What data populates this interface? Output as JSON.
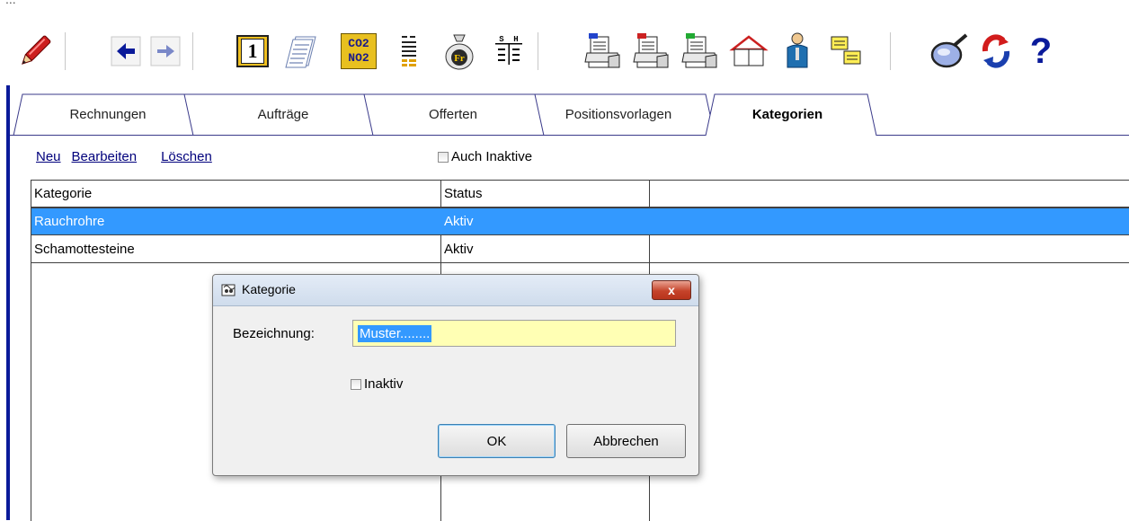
{
  "window": {
    "title_fragment": "..."
  },
  "toolbar": {
    "icons": [
      "pen-icon",
      "back-arrow-icon",
      "forward-arrow-icon",
      "day-one-icon",
      "stack-documents-icon",
      "co2-no2-icon",
      "list-icon",
      "money-bag-icon",
      "sh-columns-icon",
      "printer-blue-icon",
      "printer-red-icon",
      "printer-green-icon",
      "house-icon",
      "person-icon",
      "cards-icon",
      "magnifier-icon",
      "refresh-icon",
      "help-icon"
    ],
    "co2_top": "CO2",
    "co2_bottom": "NO2",
    "day_number": "1",
    "money_label": "Fr",
    "sh_left": "S",
    "sh_right": "H",
    "help_label": "?"
  },
  "tabs": [
    {
      "label": "Rechnungen"
    },
    {
      "label": "Aufträge"
    },
    {
      "label": "Offerten"
    },
    {
      "label": "Positionsvorlagen"
    },
    {
      "label": "Kategorien",
      "active": true
    }
  ],
  "actions": {
    "new": "Neu",
    "edit": "Bearbeiten",
    "delete": "Löschen",
    "show_inactive": "Auch Inaktive"
  },
  "grid": {
    "columns": [
      "Kategorie",
      "Status",
      ""
    ],
    "rows": [
      {
        "kategorie": "Rauchrohre",
        "status": "Aktiv",
        "selected": true
      },
      {
        "kategorie": "Schamottesteine",
        "status": "Aktiv",
        "selected": false
      }
    ]
  },
  "dialog": {
    "title": "Kategorie",
    "close_label": "x",
    "label_bezeichnung": "Bezeichnung:",
    "value_bezeichnung": "Muster........",
    "checkbox_inaktiv": "Inaktiv",
    "ok": "OK",
    "cancel": "Abbrechen"
  },
  "colors": {
    "selection": "#3399ff",
    "input_bg": "#ffffb4",
    "link": "#00007c",
    "tab_border": "#3a3a8a",
    "left_edge": "#0a1a9a"
  }
}
